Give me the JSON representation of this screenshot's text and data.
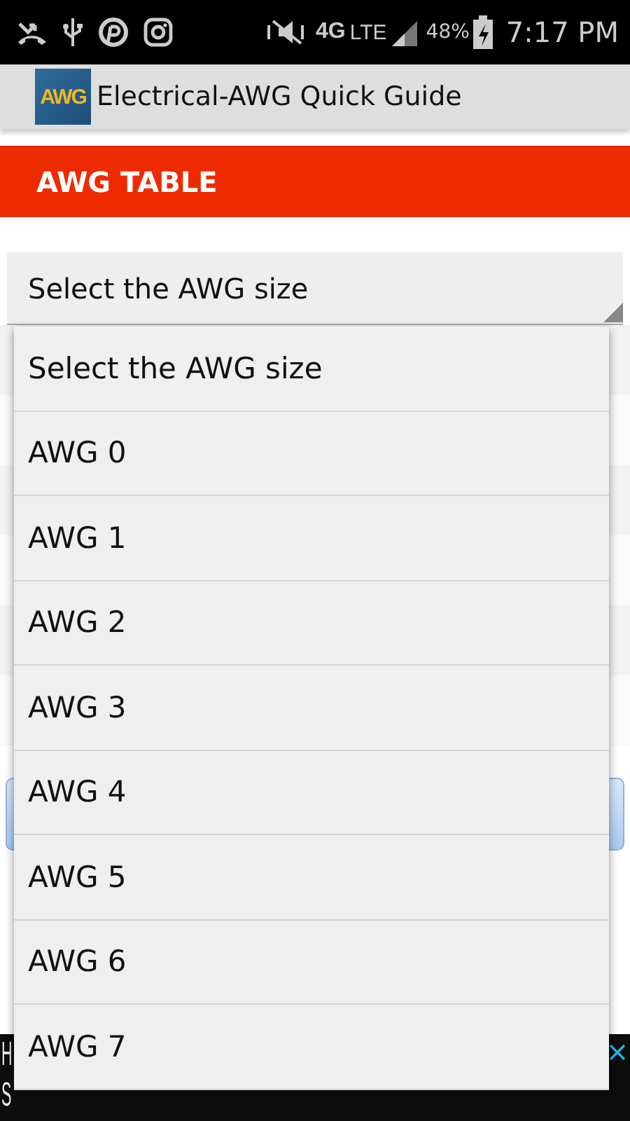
{
  "status_bar": {
    "network": "4G",
    "network_sub": "LTE",
    "battery": "48%",
    "time": "7:17 PM"
  },
  "app_bar": {
    "logo": "AWG",
    "title": "Electrical-AWG Quick Guide"
  },
  "section_header": "AWG TABLE",
  "spinner": {
    "value": "Select the AWG size"
  },
  "dropdown": {
    "options": [
      "Select the AWG size",
      "AWG 0",
      "AWG 1",
      "AWG 2",
      "AWG 3",
      "AWG 4",
      "AWG 5",
      "AWG 6",
      "AWG 7"
    ]
  },
  "ad_banner": {
    "line_1": "H",
    "line_2": "S"
  }
}
